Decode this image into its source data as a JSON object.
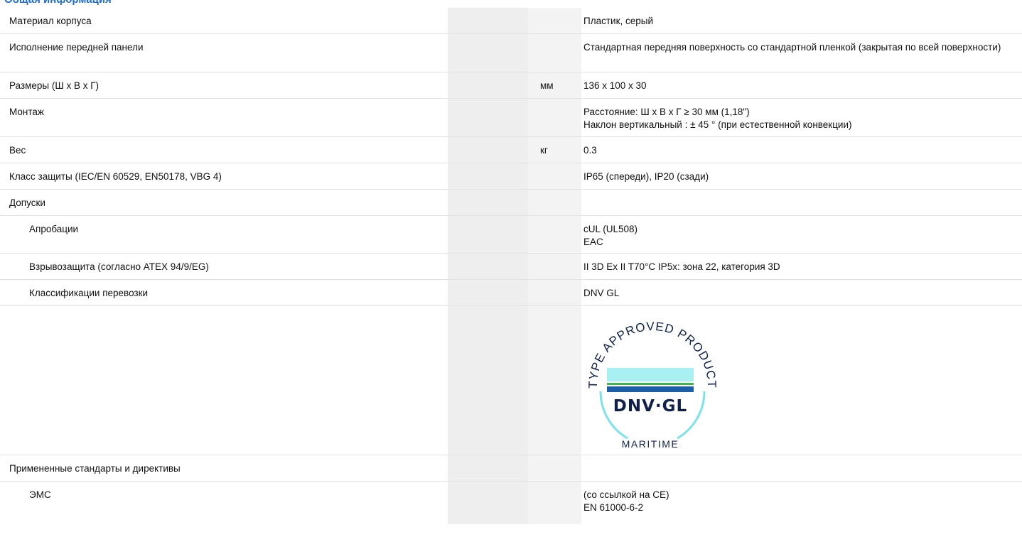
{
  "section_title": "Общая информация",
  "rows": [
    {
      "label": "Материал корпуса",
      "unit": "",
      "value": [
        "Пластик, серый"
      ]
    },
    {
      "label": "Исполнение передней панели",
      "unit": "",
      "value": [
        "Стандартная передняя поверхность со стандартной пленкой (закрытая по всей поверхности)"
      ]
    },
    {
      "label": "Размеры (Ш x В x Г)",
      "unit": "мм",
      "value": [
        "136 x 100 x 30"
      ]
    },
    {
      "label": "Монтаж",
      "unit": "",
      "value": [
        "Расстояние: Ш x В x Г ≥ 30 мм (1,18\")",
        "Наклон вертикальный : ± 45 ° (при естественной конвекции)"
      ]
    },
    {
      "label": "Вес",
      "unit": "кг",
      "value": [
        "0.3"
      ]
    },
    {
      "label": "Класс защиты (IEC/EN 60529, EN50178, VBG 4)",
      "unit": "",
      "value": [
        "IP65 (спереди), IP20 (сзади)"
      ]
    },
    {
      "label": "Допуски",
      "unit": "",
      "value": [
        ""
      ]
    },
    {
      "label": "Апробации",
      "unit": "",
      "value": [
        "cUL (UL508)",
        "EAC"
      ]
    },
    {
      "label": "Взрывозащита (согласно ATEX 94/9/EG)",
      "unit": "",
      "value": [
        "II 3D Ex II T70°C IP5x: зона 22, категория 3D"
      ]
    },
    {
      "label": "Классификации перевозки",
      "unit": "",
      "value": [
        "DNV GL"
      ]
    },
    {
      "label": "",
      "unit": "",
      "value": []
    },
    {
      "label": "Примененные стандарты и директивы",
      "unit": "",
      "value": [
        ""
      ]
    },
    {
      "label": "ЭМС",
      "unit": "",
      "value": [
        "(со ссылкой на CE)",
        "EN 61000-6-2"
      ]
    }
  ],
  "logo": {
    "arc_text": "TYPE APPROVED PRODUCT",
    "brand": "DNV·GL",
    "sub": "MARITIME",
    "colors": {
      "cyan": "#7de3ea",
      "green": "#3cb54a",
      "blue": "#1c5fa8",
      "navy": "#0f204b"
    }
  }
}
